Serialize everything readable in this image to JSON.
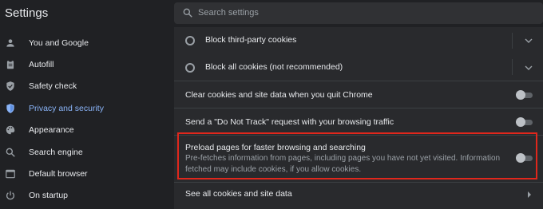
{
  "app": {
    "title": "Settings"
  },
  "search": {
    "placeholder": "Search settings"
  },
  "sidebar": {
    "items": [
      {
        "label": "You and Google",
        "icon": "person-icon",
        "active": false
      },
      {
        "label": "Autofill",
        "icon": "clipboard-icon",
        "active": false
      },
      {
        "label": "Safety check",
        "icon": "shield-check-icon",
        "active": false
      },
      {
        "label": "Privacy and security",
        "icon": "shield-icon",
        "active": true
      },
      {
        "label": "Appearance",
        "icon": "palette-icon",
        "active": false
      },
      {
        "label": "Search engine",
        "icon": "search-icon",
        "active": false
      },
      {
        "label": "Default browser",
        "icon": "browser-icon",
        "active": false
      },
      {
        "label": "On startup",
        "icon": "power-icon",
        "active": false
      }
    ]
  },
  "cookies": {
    "block_third_party": {
      "label": "Block third-party cookies",
      "selected": false
    },
    "block_all": {
      "label": "Block all cookies (not recommended)",
      "selected": false
    },
    "clear_on_quit": {
      "label": "Clear cookies and site data when you quit Chrome",
      "enabled": false
    },
    "do_not_track": {
      "label": "Send a \"Do Not Track\" request with your browsing traffic",
      "enabled": false
    },
    "preload": {
      "label": "Preload pages for faster browsing and searching",
      "description": "Pre-fetches information from pages, including pages you have not yet visited. Information fetched may include cookies, if you allow cookies.",
      "enabled": false
    },
    "see_all": {
      "label": "See all cookies and site data"
    }
  },
  "colors": {
    "accent": "#8ab4f8",
    "highlight_border": "#e0271c",
    "background": "#202124",
    "panel": "#292a2d"
  }
}
